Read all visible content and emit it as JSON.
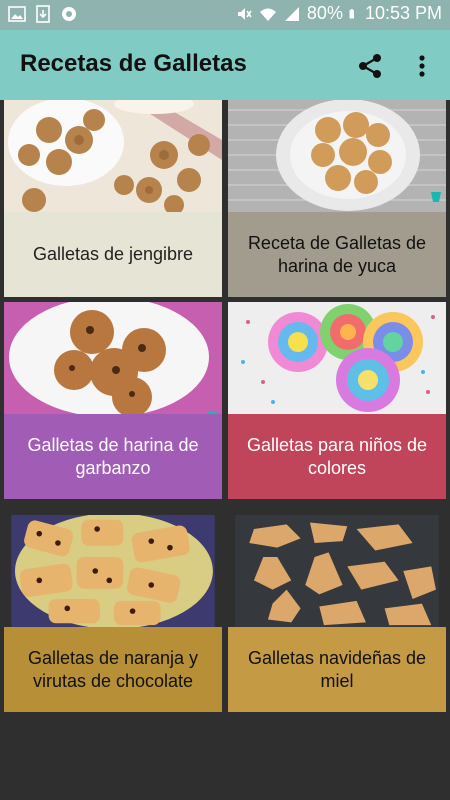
{
  "status_bar": {
    "battery": "80%",
    "time": "10:53 PM"
  },
  "app_bar": {
    "title": "Recetas de Galletas",
    "share_icon": "share-icon",
    "more_icon": "more-vert-icon"
  },
  "recipes": [
    {
      "title": "Galletas de jengibre",
      "caption_bg": "#e6e5d5",
      "caption_color": "#222222"
    },
    {
      "title": "Receta de Galletas de harina de yuca",
      "caption_bg": "#a29c8e",
      "caption_color": "#111111"
    },
    {
      "title": "Galletas de harina de garbanzo",
      "caption_bg": "#a15db5",
      "caption_color": "#ffffff"
    },
    {
      "title": "Galletas para niños de colores",
      "caption_bg": "#c0445a",
      "caption_color": "#ffffff"
    },
    {
      "title": "Galletas de naranja y virutas de chocolate",
      "caption_bg": "#b78f36",
      "caption_color": "#111111"
    },
    {
      "title": "Galletas navideñas de miel",
      "caption_bg": "#c59a45",
      "caption_color": "#111111"
    }
  ]
}
